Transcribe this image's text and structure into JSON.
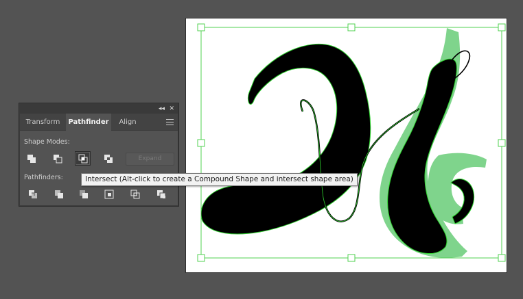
{
  "panel": {
    "collapse_glyph": "◂◂",
    "close_glyph": "✕",
    "tabs": [
      {
        "label": "Transform",
        "active": false
      },
      {
        "label": "Pathfinder",
        "active": true
      },
      {
        "label": "Align",
        "active": false
      }
    ],
    "shape_modes_label": "Shape Modes:",
    "shape_modes": [
      {
        "name": "unite-icon"
      },
      {
        "name": "minus-front-icon"
      },
      {
        "name": "intersect-icon",
        "hover": true
      },
      {
        "name": "exclude-icon"
      }
    ],
    "expand_label": "Expand",
    "pathfinders_label": "Pathfinders:",
    "pathfinders": [
      {
        "name": "divide-icon"
      },
      {
        "name": "trim-icon"
      },
      {
        "name": "merge-icon"
      },
      {
        "name": "crop-icon"
      },
      {
        "name": "outline-icon"
      },
      {
        "name": "minus-back-icon"
      }
    ]
  },
  "tooltip": {
    "text": "Intersect (Alt-click to create a Compound Shape and intersect shape area)"
  },
  "colors": {
    "canvas_bg": "#535353",
    "selection": "#4fd04f",
    "shape_fill": "#000000",
    "highlight_fill": "#7fd48c"
  }
}
